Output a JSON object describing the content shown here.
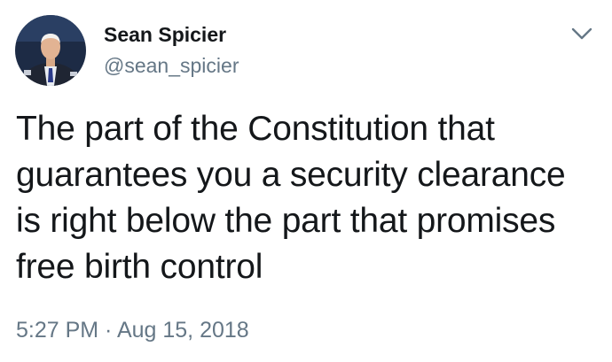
{
  "tweet": {
    "author": {
      "display_name": "Sean Spicier",
      "handle": "@sean_spicier",
      "avatar_icon": "profile-photo"
    },
    "menu_icon": "chevron-down-icon",
    "text": "The part of the Constitution that\nguarantees you a security clearance\nis right below the part that promises\nfree birth control",
    "timestamp": "5:27 PM · Aug 15, 2018"
  },
  "colors": {
    "primary_text": "#14171a",
    "secondary_text": "#657786",
    "background": "#ffffff"
  }
}
